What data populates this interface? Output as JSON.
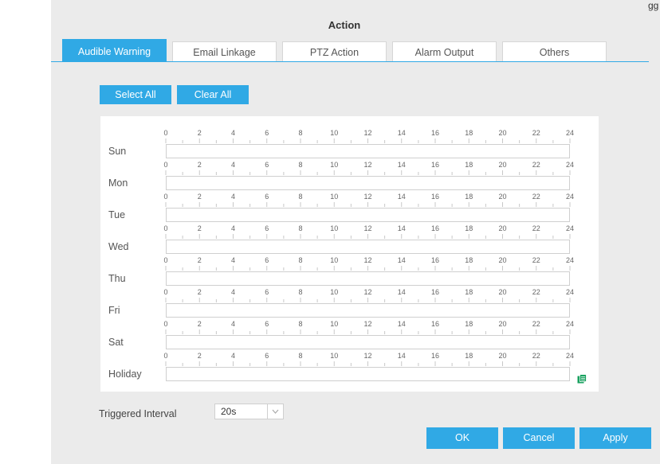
{
  "dialog": {
    "title": "Action",
    "partial_corner_label": "gg"
  },
  "tabs": [
    {
      "label": "Audible Warning",
      "active": true
    },
    {
      "label": "Email Linkage",
      "active": false
    },
    {
      "label": "PTZ Action",
      "active": false
    },
    {
      "label": "Alarm Output",
      "active": false
    },
    {
      "label": "Others",
      "active": false
    }
  ],
  "schedule": {
    "select_all_label": "Select All",
    "clear_all_label": "Clear All",
    "hour_ticks": [
      "0",
      "2",
      "4",
      "6",
      "8",
      "10",
      "12",
      "14",
      "16",
      "18",
      "20",
      "22",
      "24"
    ],
    "days": [
      "Sun",
      "Mon",
      "Tue",
      "Wed",
      "Thu",
      "Fri",
      "Sat",
      "Holiday"
    ]
  },
  "triggered_interval": {
    "label": "Triggered Interval",
    "value": "20s"
  },
  "footer": {
    "ok_label": "OK",
    "cancel_label": "Cancel",
    "apply_label": "Apply"
  },
  "colors": {
    "accent": "#30a9e5",
    "copy_icon": "#19a15f",
    "background": "#ebebeb"
  }
}
